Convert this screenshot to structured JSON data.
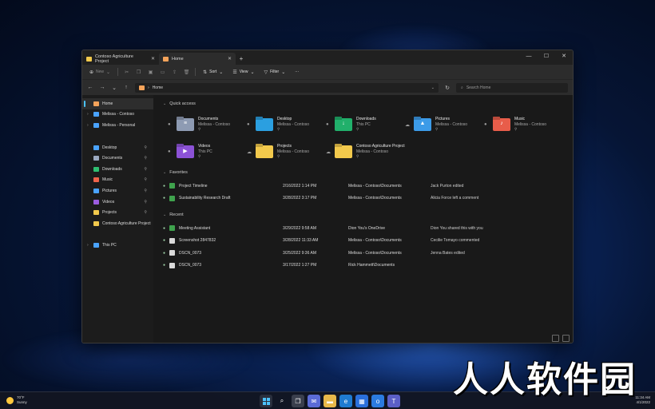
{
  "window": {
    "tabs": [
      {
        "label": "Contoso Agriculture Project"
      },
      {
        "label": "Home"
      }
    ],
    "controls": {
      "minimize": "—",
      "maximize": "☐",
      "close": "✕"
    }
  },
  "toolbar": {
    "new_label": "New",
    "sort_label": "Sort",
    "view_label": "View",
    "filter_label": "Filter",
    "more_label": "···"
  },
  "address": {
    "path_label": "Home",
    "search_placeholder": "Search Home"
  },
  "sidebar": {
    "top": [
      {
        "label": "Home",
        "color": "#f5a35a"
      },
      {
        "label": "Melissa - Contoso",
        "color": "#4aa3ff"
      },
      {
        "label": "Melissa - Personal",
        "color": "#4aa3ff"
      }
    ],
    "pinned": [
      {
        "label": "Desktop",
        "color": "#4aa3ff"
      },
      {
        "label": "Documents",
        "color": "#9aa8c0"
      },
      {
        "label": "Downloads",
        "color": "#2fbf71"
      },
      {
        "label": "Music",
        "color": "#f0634a"
      },
      {
        "label": "Pictures",
        "color": "#4aa3ff"
      },
      {
        "label": "Videos",
        "color": "#9c5ce0"
      },
      {
        "label": "Projects",
        "color": "#f2c94c"
      },
      {
        "label": "Contoso Agriculture Project",
        "color": "#f2c94c"
      }
    ],
    "bottom": [
      {
        "label": "This PC",
        "color": "#4aa3ff"
      }
    ]
  },
  "quick_access": {
    "title": "Quick access",
    "items": [
      {
        "name": "Documents",
        "sub": "Melissa - Contoso",
        "color": "#8e9bb3",
        "glyph": "≡"
      },
      {
        "name": "Desktop",
        "sub": "Melissa - Contoso",
        "color": "#2b9fe0",
        "glyph": ""
      },
      {
        "name": "Downloads",
        "sub": "This PC",
        "color": "#21b06b",
        "glyph": "↓"
      },
      {
        "name": "Pictures",
        "sub": "Melissa - Contoso",
        "color": "#3c9be8",
        "glyph": "▲"
      },
      {
        "name": "Music",
        "sub": "Melissa - Contoso",
        "color": "#e85d4a",
        "glyph": "♪"
      },
      {
        "name": "Videos",
        "sub": "This PC",
        "color": "#8c52d6",
        "glyph": "▶"
      },
      {
        "name": "Projects",
        "sub": "Melissa - Contoso",
        "color": "#f2c94c",
        "glyph": ""
      },
      {
        "name": "Contoso Agriculture Project",
        "sub": "Melissa - Contoso",
        "color": "#f2c94c",
        "glyph": ""
      }
    ]
  },
  "favorites": {
    "title": "Favorites",
    "rows": [
      {
        "name": "Project Timeline",
        "date": "2/16/2022 1:14 PM",
        "location": "Melissa - Contoso\\Documents",
        "activity": "Jack Purton edited",
        "color": "#3fa34d"
      },
      {
        "name": "Sustainability Research Draft",
        "date": "3/28/2022 3:17 PM",
        "location": "Melissa - Contoso\\Documents",
        "activity": "Alicia Force left a comment",
        "color": "#3fa34d"
      }
    ]
  },
  "recent": {
    "title": "Recent",
    "rows": [
      {
        "name": "Meeting Assistant",
        "date": "3/29/2022 9:58 AM",
        "location": "Dion You's OneDrive",
        "activity": "Dion You shared this with you",
        "color": "#3fa34d"
      },
      {
        "name": "Screenshot 2847832",
        "date": "3/28/2022 11:33 AM",
        "location": "Melissa - Contoso\\Documents",
        "activity": "Cecilie Tomayo commented",
        "color": "#d9d9d9"
      },
      {
        "name": "DSCN_0073",
        "date": "3/25/2022 9:36 AM",
        "location": "Melissa - Contoso\\Documents",
        "activity": "Jenna Bates edited",
        "color": "#d9d9d9"
      },
      {
        "name": "DSCN_0073",
        "date": "3/17/2022 1:27 PM",
        "location": "Rick Hammett\\Documents",
        "activity": "",
        "color": "#d9d9d9"
      }
    ]
  },
  "taskbar": {
    "weather_temp": "70°F",
    "weather_desc": "Sunny",
    "time": "11:34 AM",
    "date": "4/1/2022"
  },
  "watermark": "人人软件园"
}
